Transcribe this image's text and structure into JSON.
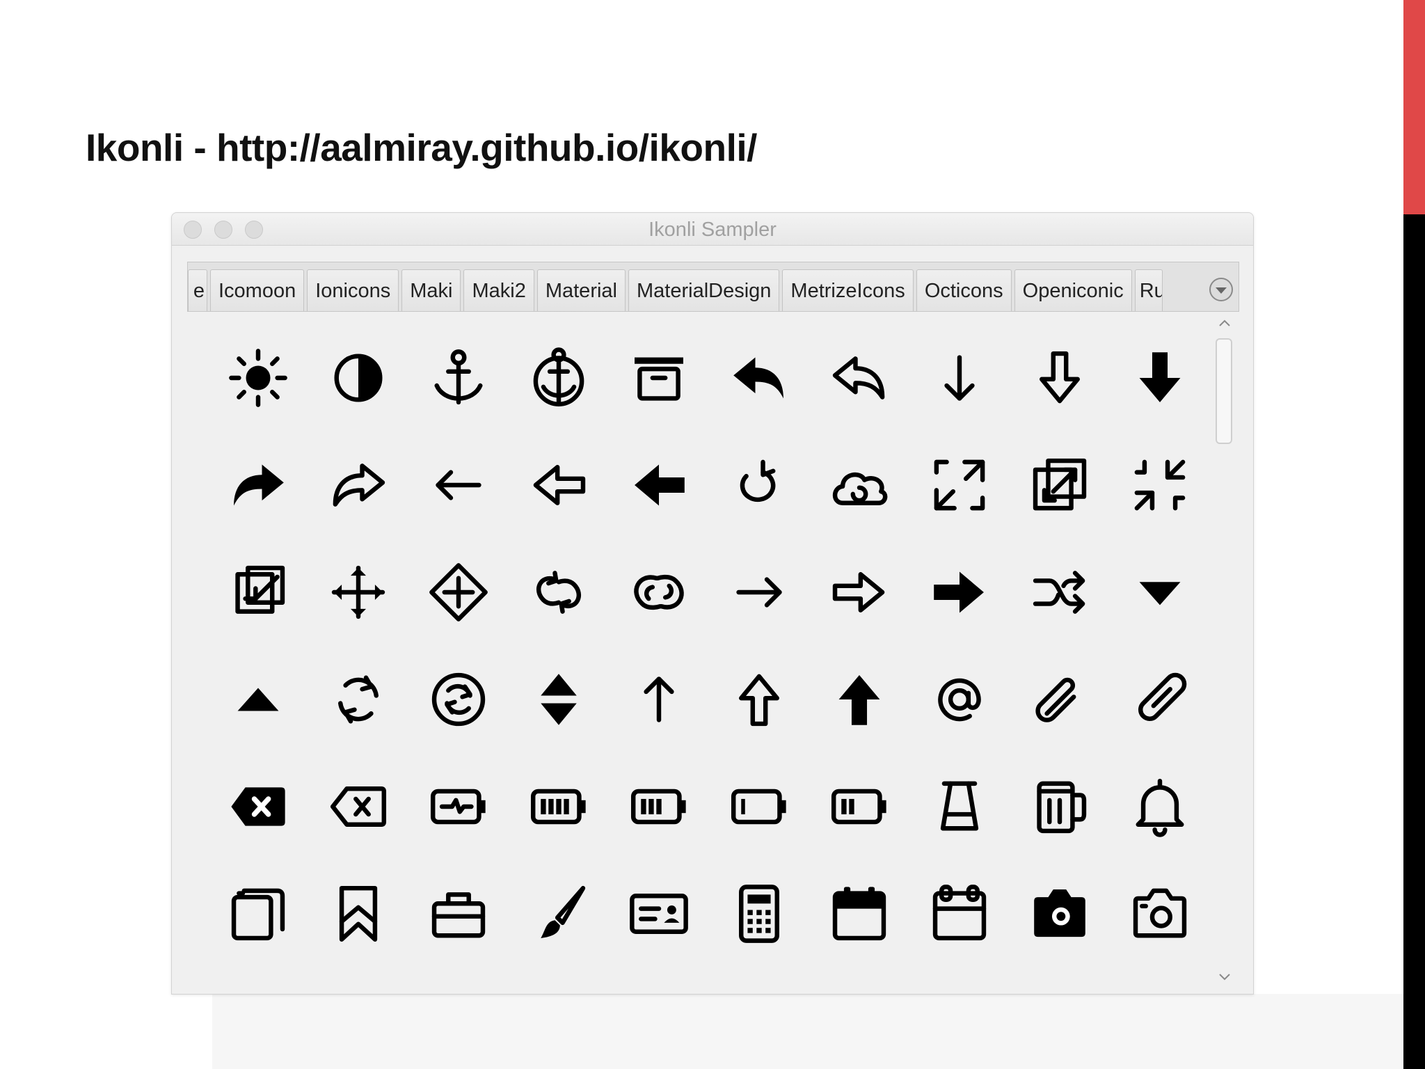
{
  "slide": {
    "title": "Ikonli - http://aalmiray.github.io/ikonli/",
    "accent_red": "#e04848",
    "accent_black": "#000000"
  },
  "window": {
    "title": "Ikonli Sampler",
    "tabs": [
      "e",
      "Icomoon",
      "Ionicons",
      "Maki",
      "Maki2",
      "Material",
      "MaterialDesign",
      "MetrizeIcons",
      "Octicons",
      "Openiconic",
      "Ru"
    ],
    "selected_tab": null,
    "tab_menu_icon": "chevron-down-circle-icon"
  },
  "icons": [
    "brightness-icon",
    "contrast-icon",
    "anchor-icon",
    "anchor-circle-icon",
    "archive-icon",
    "reply-filled-icon",
    "reply-outline-icon",
    "arrow-down-thin-icon",
    "arrow-down-outline-icon",
    "arrow-down-filled-icon",
    "forward-filled-icon",
    "forward-outline-icon",
    "arrow-left-thin-icon",
    "arrow-left-outline-icon",
    "arrow-left-filled-icon",
    "loop-back-icon",
    "cloud-loop-icon",
    "expand-icon",
    "expand-box-icon",
    "contract-icon",
    "contract-box-icon",
    "move-icon",
    "move-diamond-icon",
    "link-loop-icon",
    "link-loop-outline-icon",
    "arrow-right-thin-icon",
    "arrow-right-outline-icon",
    "arrow-right-filled-icon",
    "shuffle-icon",
    "caret-down-icon",
    "caret-up-icon",
    "sync-icon",
    "sync-circle-icon",
    "sort-icon",
    "arrow-up-thin-icon",
    "arrow-up-outline-icon",
    "arrow-up-filled-icon",
    "at-icon",
    "paperclip-icon",
    "paperclip-outline-icon",
    "backspace-filled-icon",
    "backspace-outline-icon",
    "battery-charging-icon",
    "battery-full-icon",
    "battery-three-quarter-icon",
    "battery-empty-icon",
    "battery-low-icon",
    "beaker-icon",
    "beer-icon",
    "bell-icon",
    "copy-stack-icon",
    "bookmark-icon",
    "briefcase-icon",
    "brush-icon",
    "id-card-icon",
    "calculator-icon",
    "calendar-filled-icon",
    "calendar-outline-icon",
    "camera-filled-icon",
    "camera-outline-icon"
  ]
}
